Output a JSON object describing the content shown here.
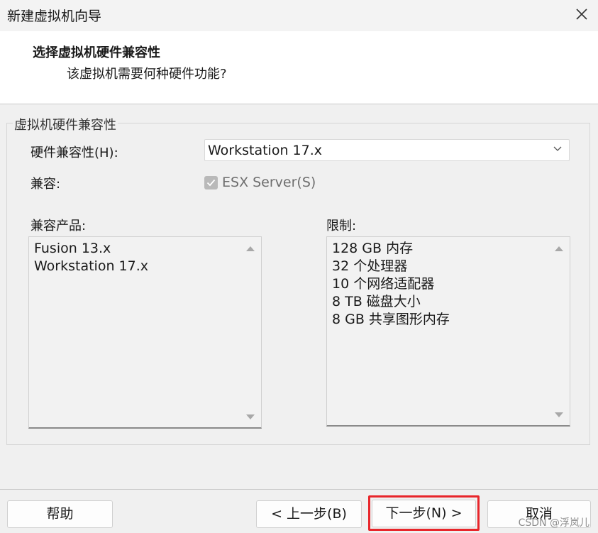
{
  "window": {
    "title": "新建虚拟机向导",
    "close_icon": "close-icon"
  },
  "header": {
    "title": "选择虚拟机硬件兼容性",
    "subtitle": "该虚拟机需要何种硬件功能?"
  },
  "group": {
    "legend": "虚拟机硬件兼容性",
    "hw_compat_label": "硬件兼容性(H):",
    "hw_compat_value": "Workstation 17.x",
    "compat_label": "兼容:",
    "esx_checkbox": {
      "label": "ESX Server(S)",
      "checked": true,
      "disabled": true
    },
    "products_label": "兼容产品:",
    "products": [
      "Fusion 13.x",
      "Workstation 17.x"
    ],
    "limits_label": "限制:",
    "limits": [
      "128 GB 内存",
      "32 个处理器",
      "10 个网络适配器",
      "8 TB 磁盘大小",
      "8 GB 共享图形内存"
    ]
  },
  "footer": {
    "help": "帮助",
    "back": "< 上一步(B)",
    "next": "下一步(N) >",
    "cancel": "取消"
  },
  "watermark": "CSDN @浮岚儿",
  "colors": {
    "highlight": "#e8262b"
  }
}
